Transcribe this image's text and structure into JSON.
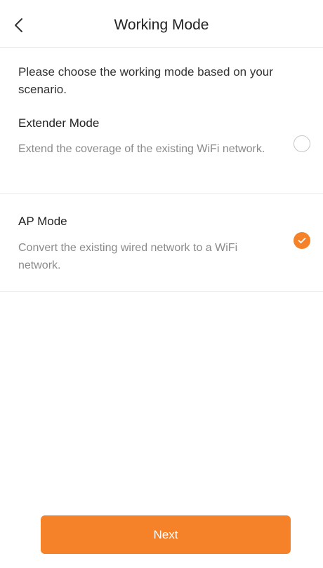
{
  "header": {
    "title": "Working Mode",
    "back_icon": "chevron-left-icon"
  },
  "intro_text": "Please choose the working mode based on your scenario.",
  "options": [
    {
      "title": "Extender Mode",
      "description": "Extend the coverage of the existing WiFi network.",
      "selected": false
    },
    {
      "title": "AP Mode",
      "description": "Convert the existing wired network to a WiFi network.",
      "selected": true
    }
  ],
  "next_button": {
    "label": "Next"
  },
  "colors": {
    "accent": "#f58228",
    "text_primary": "#222222",
    "text_secondary": "#8a8a8a",
    "divider": "#ececec"
  }
}
